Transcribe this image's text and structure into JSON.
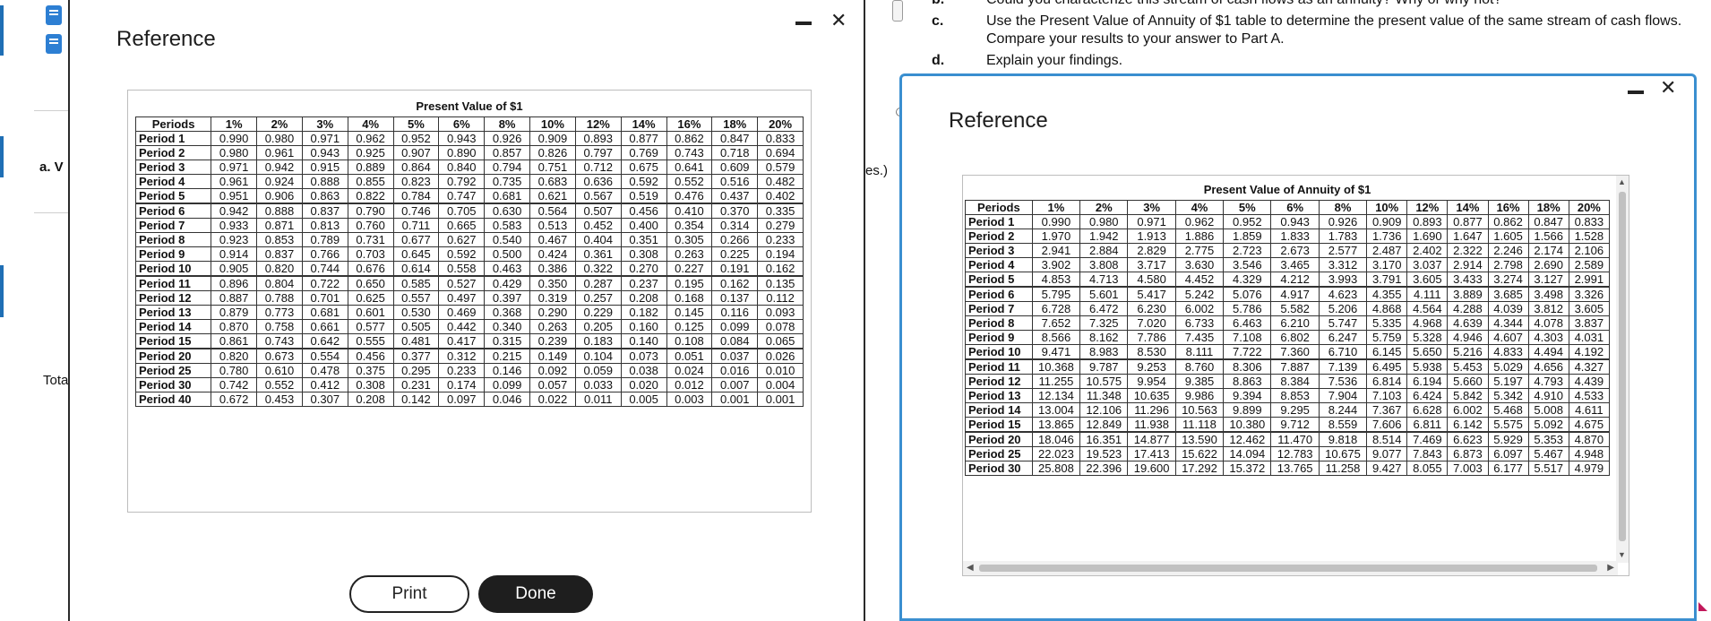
{
  "background": {
    "left_labels": [
      "a. V",
      "Tota"
    ],
    "answer_hint": "es.)",
    "question_top_fragment": "Could you characterize this stream of cash flows as an annuity? Why or why not?",
    "question_letter_b": "b.",
    "question_c_letter": "c.",
    "question_c_line1": "Use the Present Value of Annuity of $1 table to determine the present value of the same stream of cash flows.",
    "question_c_line2": "Compare your results to your answer to Part A.",
    "question_d_letter": "d.",
    "question_d_text": "Explain your findings."
  },
  "modal_pv": {
    "title": "Reference",
    "minimize_label": "—",
    "close_label": "✕",
    "table_caption": "Present Value of $1",
    "columns": [
      "Periods",
      "1%",
      "2%",
      "3%",
      "4%",
      "5%",
      "6%",
      "8%",
      "10%",
      "12%",
      "14%",
      "16%",
      "18%",
      "20%"
    ],
    "groups": [
      [
        [
          "Period 1",
          "0.990",
          "0.980",
          "0.971",
          "0.962",
          "0.952",
          "0.943",
          "0.926",
          "0.909",
          "0.893",
          "0.877",
          "0.862",
          "0.847",
          "0.833"
        ],
        [
          "Period 2",
          "0.980",
          "0.961",
          "0.943",
          "0.925",
          "0.907",
          "0.890",
          "0.857",
          "0.826",
          "0.797",
          "0.769",
          "0.743",
          "0.718",
          "0.694"
        ],
        [
          "Period 3",
          "0.971",
          "0.942",
          "0.915",
          "0.889",
          "0.864",
          "0.840",
          "0.794",
          "0.751",
          "0.712",
          "0.675",
          "0.641",
          "0.609",
          "0.579"
        ],
        [
          "Period 4",
          "0.961",
          "0.924",
          "0.888",
          "0.855",
          "0.823",
          "0.792",
          "0.735",
          "0.683",
          "0.636",
          "0.592",
          "0.552",
          "0.516",
          "0.482"
        ],
        [
          "Period 5",
          "0.951",
          "0.906",
          "0.863",
          "0.822",
          "0.784",
          "0.747",
          "0.681",
          "0.621",
          "0.567",
          "0.519",
          "0.476",
          "0.437",
          "0.402"
        ]
      ],
      [
        [
          "Period 6",
          "0.942",
          "0.888",
          "0.837",
          "0.790",
          "0.746",
          "0.705",
          "0.630",
          "0.564",
          "0.507",
          "0.456",
          "0.410",
          "0.370",
          "0.335"
        ],
        [
          "Period 7",
          "0.933",
          "0.871",
          "0.813",
          "0.760",
          "0.711",
          "0.665",
          "0.583",
          "0.513",
          "0.452",
          "0.400",
          "0.354",
          "0.314",
          "0.279"
        ],
        [
          "Period 8",
          "0.923",
          "0.853",
          "0.789",
          "0.731",
          "0.677",
          "0.627",
          "0.540",
          "0.467",
          "0.404",
          "0.351",
          "0.305",
          "0.266",
          "0.233"
        ],
        [
          "Period 9",
          "0.914",
          "0.837",
          "0.766",
          "0.703",
          "0.645",
          "0.592",
          "0.500",
          "0.424",
          "0.361",
          "0.308",
          "0.263",
          "0.225",
          "0.194"
        ],
        [
          "Period 10",
          "0.905",
          "0.820",
          "0.744",
          "0.676",
          "0.614",
          "0.558",
          "0.463",
          "0.386",
          "0.322",
          "0.270",
          "0.227",
          "0.191",
          "0.162"
        ]
      ],
      [
        [
          "Period 11",
          "0.896",
          "0.804",
          "0.722",
          "0.650",
          "0.585",
          "0.527",
          "0.429",
          "0.350",
          "0.287",
          "0.237",
          "0.195",
          "0.162",
          "0.135"
        ],
        [
          "Period 12",
          "0.887",
          "0.788",
          "0.701",
          "0.625",
          "0.557",
          "0.497",
          "0.397",
          "0.319",
          "0.257",
          "0.208",
          "0.168",
          "0.137",
          "0.112"
        ],
        [
          "Period 13",
          "0.879",
          "0.773",
          "0.681",
          "0.601",
          "0.530",
          "0.469",
          "0.368",
          "0.290",
          "0.229",
          "0.182",
          "0.145",
          "0.116",
          "0.093"
        ],
        [
          "Period 14",
          "0.870",
          "0.758",
          "0.661",
          "0.577",
          "0.505",
          "0.442",
          "0.340",
          "0.263",
          "0.205",
          "0.160",
          "0.125",
          "0.099",
          "0.078"
        ],
        [
          "Period 15",
          "0.861",
          "0.743",
          "0.642",
          "0.555",
          "0.481",
          "0.417",
          "0.315",
          "0.239",
          "0.183",
          "0.140",
          "0.108",
          "0.084",
          "0.065"
        ]
      ],
      [
        [
          "Period 20",
          "0.820",
          "0.673",
          "0.554",
          "0.456",
          "0.377",
          "0.312",
          "0.215",
          "0.149",
          "0.104",
          "0.073",
          "0.051",
          "0.037",
          "0.026"
        ],
        [
          "Period 25",
          "0.780",
          "0.610",
          "0.478",
          "0.375",
          "0.295",
          "0.233",
          "0.146",
          "0.092",
          "0.059",
          "0.038",
          "0.024",
          "0.016",
          "0.010"
        ],
        [
          "Period 30",
          "0.742",
          "0.552",
          "0.412",
          "0.308",
          "0.231",
          "0.174",
          "0.099",
          "0.057",
          "0.033",
          "0.020",
          "0.012",
          "0.007",
          "0.004"
        ],
        [
          "Period 40",
          "0.672",
          "0.453",
          "0.307",
          "0.208",
          "0.142",
          "0.097",
          "0.046",
          "0.022",
          "0.011",
          "0.005",
          "0.003",
          "0.001",
          "0.001"
        ]
      ]
    ],
    "print_label": "Print",
    "done_label": "Done"
  },
  "modal_pva": {
    "title": "Reference",
    "minimize_label": "—",
    "close_label": "✕",
    "table_caption": "Present Value of Annuity of $1",
    "columns": [
      "Periods",
      "1%",
      "2%",
      "3%",
      "4%",
      "5%",
      "6%",
      "8%",
      "10%",
      "12%",
      "14%",
      "16%",
      "18%",
      "20%"
    ],
    "groups": [
      [
        [
          "Period 1",
          "0.990",
          "0.980",
          "0.971",
          "0.962",
          "0.952",
          "0.943",
          "0.926",
          "0.909",
          "0.893",
          "0.877",
          "0.862",
          "0.847",
          "0.833"
        ],
        [
          "Period 2",
          "1.970",
          "1.942",
          "1.913",
          "1.886",
          "1.859",
          "1.833",
          "1.783",
          "1.736",
          "1.690",
          "1.647",
          "1.605",
          "1.566",
          "1.528"
        ],
        [
          "Period 3",
          "2.941",
          "2.884",
          "2.829",
          "2.775",
          "2.723",
          "2.673",
          "2.577",
          "2.487",
          "2.402",
          "2.322",
          "2.246",
          "2.174",
          "2.106"
        ],
        [
          "Period 4",
          "3.902",
          "3.808",
          "3.717",
          "3.630",
          "3.546",
          "3.465",
          "3.312",
          "3.170",
          "3.037",
          "2.914",
          "2.798",
          "2.690",
          "2.589"
        ],
        [
          "Period 5",
          "4.853",
          "4.713",
          "4.580",
          "4.452",
          "4.329",
          "4.212",
          "3.993",
          "3.791",
          "3.605",
          "3.433",
          "3.274",
          "3.127",
          "2.991"
        ]
      ],
      [
        [
          "Period 6",
          "5.795",
          "5.601",
          "5.417",
          "5.242",
          "5.076",
          "4.917",
          "4.623",
          "4.355",
          "4.111",
          "3.889",
          "3.685",
          "3.498",
          "3.326"
        ],
        [
          "Period 7",
          "6.728",
          "6.472",
          "6.230",
          "6.002",
          "5.786",
          "5.582",
          "5.206",
          "4.868",
          "4.564",
          "4.288",
          "4.039",
          "3.812",
          "3.605"
        ],
        [
          "Period 8",
          "7.652",
          "7.325",
          "7.020",
          "6.733",
          "6.463",
          "6.210",
          "5.747",
          "5.335",
          "4.968",
          "4.639",
          "4.344",
          "4.078",
          "3.837"
        ],
        [
          "Period 9",
          "8.566",
          "8.162",
          "7.786",
          "7.435",
          "7.108",
          "6.802",
          "6.247",
          "5.759",
          "5.328",
          "4.946",
          "4.607",
          "4.303",
          "4.031"
        ],
        [
          "Period 10",
          "9.471",
          "8.983",
          "8.530",
          "8.111",
          "7.722",
          "7.360",
          "6.710",
          "6.145",
          "5.650",
          "5.216",
          "4.833",
          "4.494",
          "4.192"
        ]
      ],
      [
        [
          "Period 11",
          "10.368",
          "9.787",
          "9.253",
          "8.760",
          "8.306",
          "7.887",
          "7.139",
          "6.495",
          "5.938",
          "5.453",
          "5.029",
          "4.656",
          "4.327"
        ],
        [
          "Period 12",
          "11.255",
          "10.575",
          "9.954",
          "9.385",
          "8.863",
          "8.384",
          "7.536",
          "6.814",
          "6.194",
          "5.660",
          "5.197",
          "4.793",
          "4.439"
        ],
        [
          "Period 13",
          "12.134",
          "11.348",
          "10.635",
          "9.986",
          "9.394",
          "8.853",
          "7.904",
          "7.103",
          "6.424",
          "5.842",
          "5.342",
          "4.910",
          "4.533"
        ],
        [
          "Period 14",
          "13.004",
          "12.106",
          "11.296",
          "10.563",
          "9.899",
          "9.295",
          "8.244",
          "7.367",
          "6.628",
          "6.002",
          "5.468",
          "5.008",
          "4.611"
        ],
        [
          "Period 15",
          "13.865",
          "12.849",
          "11.938",
          "11.118",
          "10.380",
          "9.712",
          "8.559",
          "7.606",
          "6.811",
          "6.142",
          "5.575",
          "5.092",
          "4.675"
        ]
      ],
      [
        [
          "Period 20",
          "18.046",
          "16.351",
          "14.877",
          "13.590",
          "12.462",
          "11.470",
          "9.818",
          "8.514",
          "7.469",
          "6.623",
          "5.929",
          "5.353",
          "4.870"
        ],
        [
          "Period 25",
          "22.023",
          "19.523",
          "17.413",
          "15.622",
          "14.094",
          "12.783",
          "10.675",
          "9.077",
          "7.843",
          "6.873",
          "6.097",
          "5.467",
          "4.948"
        ],
        [
          "Period 30",
          "25.808",
          "22.396",
          "19.600",
          "17.292",
          "15.372",
          "13.765",
          "11.258",
          "9.427",
          "8.055",
          "7.003",
          "6.177",
          "5.517",
          "4.979"
        ]
      ]
    ],
    "scroll_up_label": "▲",
    "scroll_down_label": "▼",
    "scroll_left_label": "◀",
    "scroll_right_label": "▶"
  }
}
